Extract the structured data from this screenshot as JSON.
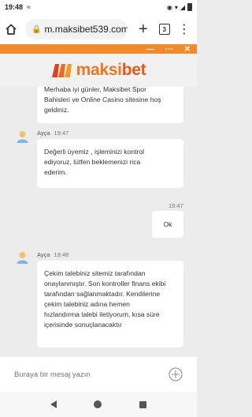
{
  "status_bar": {
    "time": "19:48"
  },
  "browser": {
    "url": "m.maksibet539.com",
    "tab_count": "3"
  },
  "brand": {
    "name_part1": "maksi",
    "name_part2": "bet"
  },
  "chat": {
    "messages": [
      {
        "text_lines": [
          "Merhaba iyi günler, Maksibet Spor",
          "Bahisleri ve Online Casino sitesine hoş",
          "geldiniz."
        ]
      },
      {
        "agent": "Ayça",
        "time": "19:47",
        "text_lines": [
          "Değerli üyemiz , işleminizi kontrol",
          "ediyoruz, lütfen beklemenizi rica",
          "ederim."
        ]
      },
      {
        "time": "19:47",
        "text": "Ok"
      },
      {
        "agent": "Ayça",
        "time": "19:48",
        "text_lines": [
          "Çekim talebiniz sitemiz tarafından",
          "onaylanmıştır. Son kontroller finans ekibi",
          "tarafından sağlanmaktadır. Kendilerine",
          "çekim talebiniz adına hemen",
          "hızlandırma talebi iletiyorum, kısa süre",
          "içerisinde sonuçlanacaktır"
        ]
      }
    ]
  },
  "composer": {
    "placeholder": "Buraya bir mesaj yazın"
  }
}
